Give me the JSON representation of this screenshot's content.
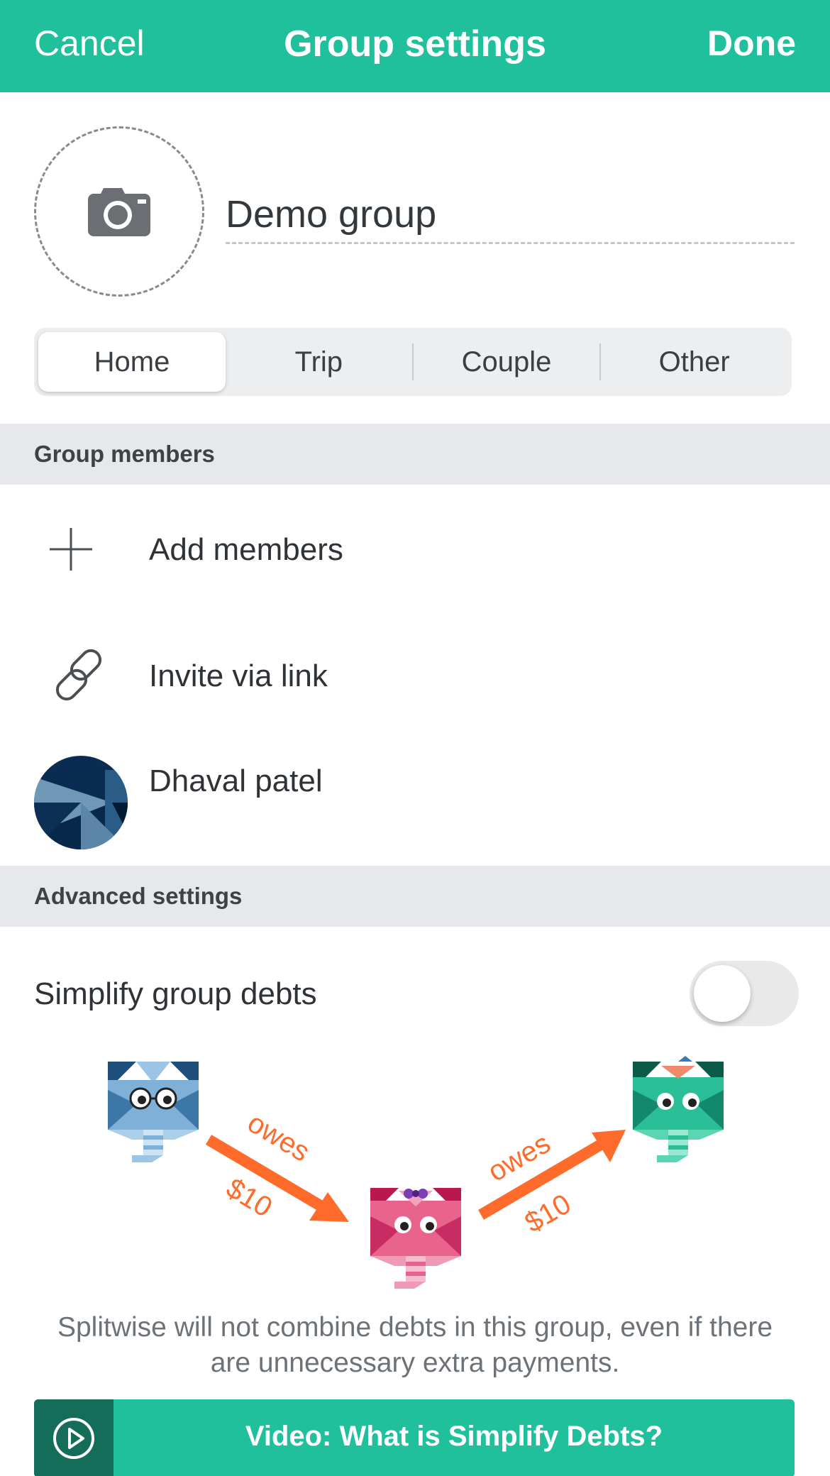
{
  "header": {
    "cancel_label": "Cancel",
    "title": "Group settings",
    "done_label": "Done"
  },
  "group": {
    "photo_icon": "camera-icon",
    "name": "Demo group"
  },
  "group_types": {
    "options": [
      "Home",
      "Trip",
      "Couple",
      "Other"
    ],
    "selected": "Home"
  },
  "members_section": {
    "title": "Group members",
    "add_label": "Add members",
    "invite_label": "Invite via link",
    "members": [
      {
        "name": "Dhaval patel"
      }
    ]
  },
  "advanced_section": {
    "title": "Advanced settings",
    "simplify_label": "Simplify group debts",
    "simplify_enabled": false,
    "illustration": {
      "owes_word": "owes",
      "amount": "$10"
    },
    "explanation": "Splitwise will not combine debts in this group, even if there are unnecessary extra payments.",
    "video_label": "Video: What is Simplify Debts?"
  },
  "colors": {
    "brand": "#1fc09b",
    "brand_dark": "#146d58",
    "arrow": "#ff6b2b",
    "section_bg": "#e7e8ec"
  }
}
